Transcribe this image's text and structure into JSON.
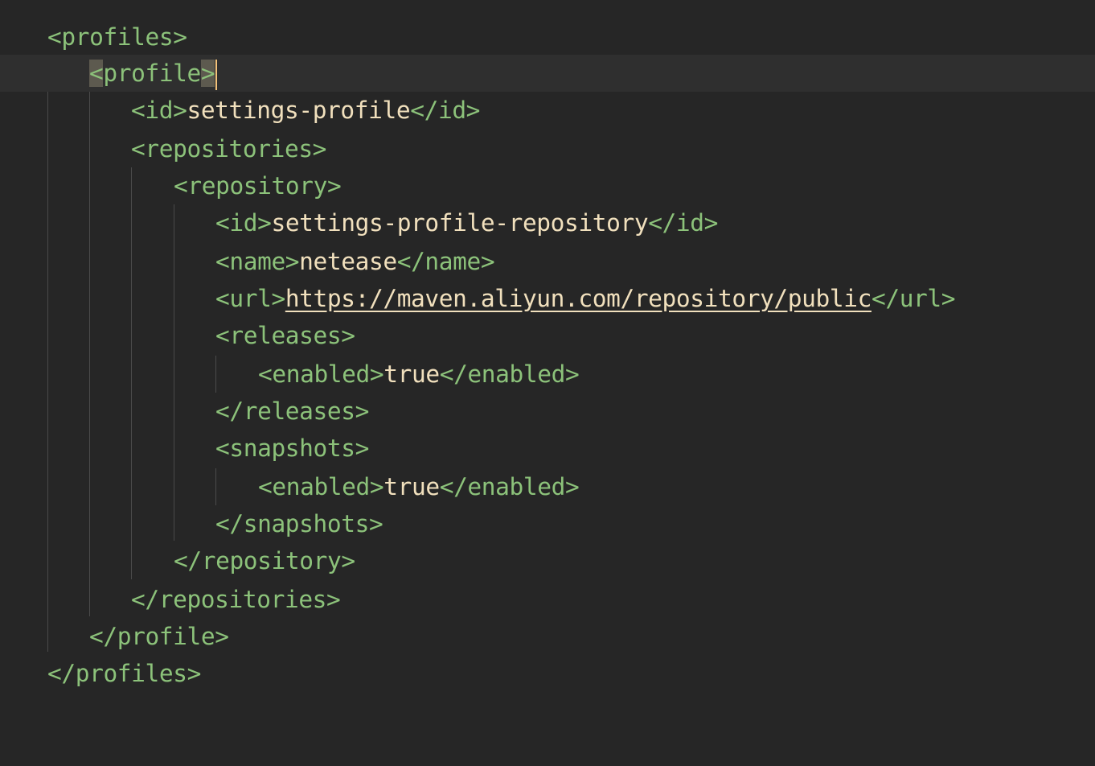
{
  "lines": [
    {
      "open": "<profiles>"
    },
    {
      "open": "<profile",
      "close": ">"
    },
    {
      "open": "<id>",
      "value": "settings-profile",
      "close": "</id>"
    },
    {
      "open": "<repositories>"
    },
    {
      "open": "<repository>"
    },
    {
      "open": "<id>",
      "value": "settings-profile-repository",
      "close": "</id>"
    },
    {
      "open": "<name>",
      "value": "netease",
      "close": "</name>"
    },
    {
      "open": "<url>",
      "value": "https://maven.aliyun.com/repository/public",
      "close": "</url>"
    },
    {
      "open": "<releases>"
    },
    {
      "open": "<enabled>",
      "value": "true",
      "close": "</enabled>"
    },
    {
      "open": "</releases>"
    },
    {
      "open": "<snapshots>"
    },
    {
      "open": "<enabled>",
      "value": "true",
      "close": "</enabled>"
    },
    {
      "open": "</snapshots>"
    },
    {
      "open": "</repository>"
    },
    {
      "open": "</repositories>"
    },
    {
      "open": "</profile>"
    },
    {
      "open": "</profiles>"
    }
  ],
  "colors": {
    "background": "#262626",
    "current_line": "#2f2f2f",
    "tag": "#8cc27a",
    "value": "#f1e0bd",
    "bracket_match": "#5d5a4f",
    "caret": "#f2c27a",
    "indent_guide": "#4a4a4a"
  }
}
